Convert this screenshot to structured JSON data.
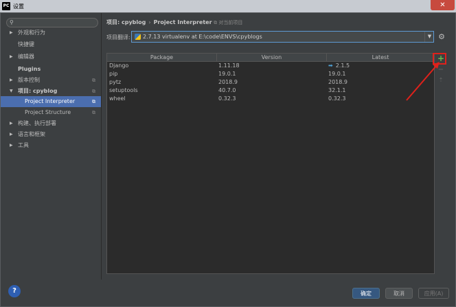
{
  "window": {
    "app_icon_text": "PC",
    "title": "设置",
    "close": "✕"
  },
  "sidebar": {
    "search_placeholder": "",
    "items": [
      {
        "label": "外观和行为",
        "arrow": "▶",
        "bold": false
      },
      {
        "label": "快捷键",
        "arrow": "",
        "bold": false
      },
      {
        "label": "编辑器",
        "arrow": "▶",
        "bold": false
      },
      {
        "label": "Plugins",
        "arrow": "",
        "bold": true
      },
      {
        "label": "版本控制",
        "arrow": "▶",
        "bold": false
      },
      {
        "label": "项目: cpyblog",
        "arrow": "▼",
        "bold": true
      },
      {
        "label": "Project Interpreter",
        "arrow": "",
        "bold": false,
        "child": true,
        "selected": true
      },
      {
        "label": "Project Structure",
        "arrow": "",
        "bold": false,
        "child": true
      },
      {
        "label": "构建、执行部署",
        "arrow": "▶",
        "bold": false
      },
      {
        "label": "语言和框架",
        "arrow": "▶",
        "bold": false
      },
      {
        "label": "工具",
        "arrow": "▶",
        "bold": false
      }
    ]
  },
  "breadcrumb": {
    "project": "项目: cpyblog",
    "separator": "›",
    "page": "Project Interpreter",
    "note": "对当前项目"
  },
  "interpreter": {
    "label": "项目翻译:",
    "value": "2.7.13 virtualenv at E:\\code\\ENVS\\cpyblogs"
  },
  "table": {
    "headers": [
      "Package",
      "Version",
      "Latest"
    ],
    "rows": [
      {
        "package": "Django",
        "version": "1.11.18",
        "latest": "2.1.5",
        "upgrade": true
      },
      {
        "package": "pip",
        "version": "19.0.1",
        "latest": "19.0.1",
        "upgrade": false
      },
      {
        "package": "pytz",
        "version": "2018.9",
        "latest": "2018.9",
        "upgrade": false
      },
      {
        "package": "setuptools",
        "version": "40.7.0",
        "latest": "32.1.1",
        "upgrade": false
      },
      {
        "package": "wheel",
        "version": "0.32.3",
        "latest": "0.32.3",
        "upgrade": false
      }
    ]
  },
  "tools": {
    "add": "+",
    "remove": "−",
    "upgrade": "⇡"
  },
  "buttons": {
    "ok": "确定",
    "cancel": "取消",
    "apply": "应用(A)",
    "help": "?"
  },
  "colors": {
    "accent_selected": "#4b6eaf",
    "highlight": "#e0211b",
    "add": "#6abf4b"
  }
}
